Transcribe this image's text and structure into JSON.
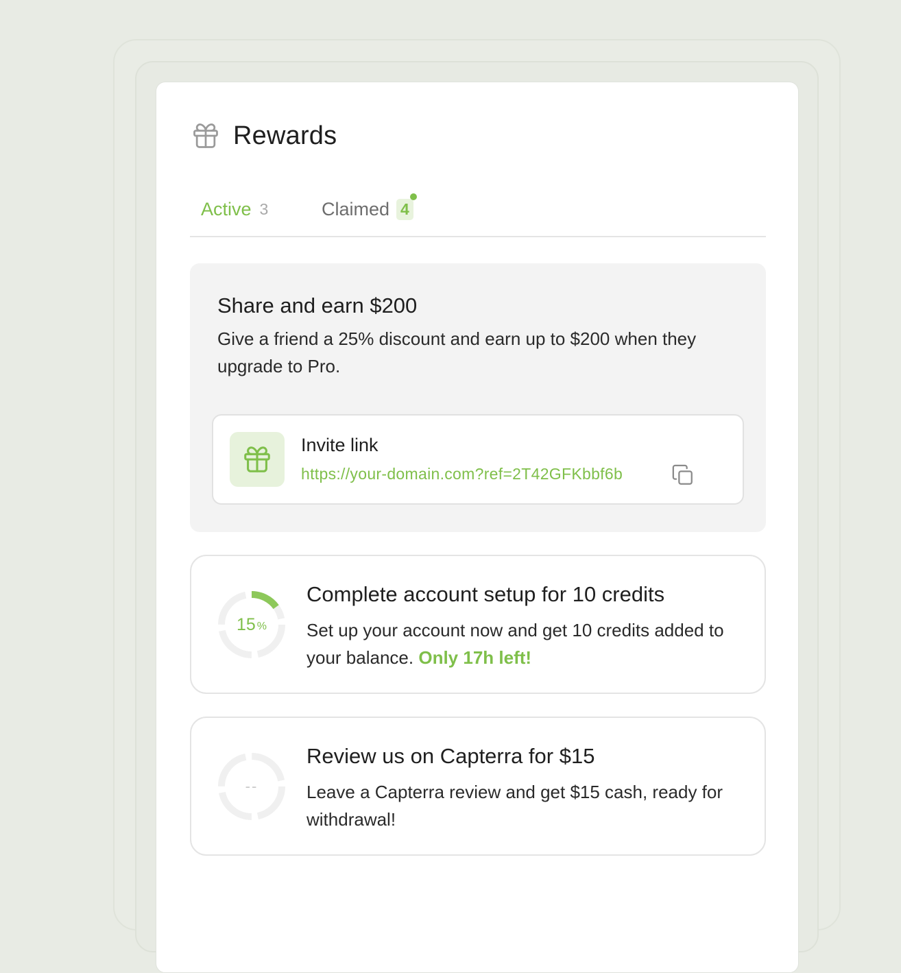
{
  "header": {
    "title": "Rewards",
    "icon": "gift-icon"
  },
  "tabs": [
    {
      "label": "Active",
      "count": "3"
    },
    {
      "label": "Claimed",
      "count": "4"
    }
  ],
  "share": {
    "title": "Share and earn $200",
    "description": "Give a friend a 25% discount and earn up to $200 when they upgrade to Pro.",
    "invite_label": "Invite link",
    "invite_url": "https://your-domain.com?ref=2T42GFKbbf6b"
  },
  "tasks": [
    {
      "progress_value": "15",
      "progress_unit": "%",
      "progress_fraction": 0.15,
      "title": "Complete account setup for 10 credits",
      "description": "Set up your account now and get 10 credits added to your balance.",
      "highlight": "Only 17h left!"
    },
    {
      "progress_value": "--",
      "title": "Review us on Capterra for $15",
      "description": "Leave a Capterra review and get $15 cash, ready for withdrawal!"
    }
  ],
  "colors": {
    "accent": "#7fbf4a",
    "accent_bg": "#e7f2dc",
    "page_bg": "#e8ebe4",
    "card_bg": "#f3f3f3"
  }
}
